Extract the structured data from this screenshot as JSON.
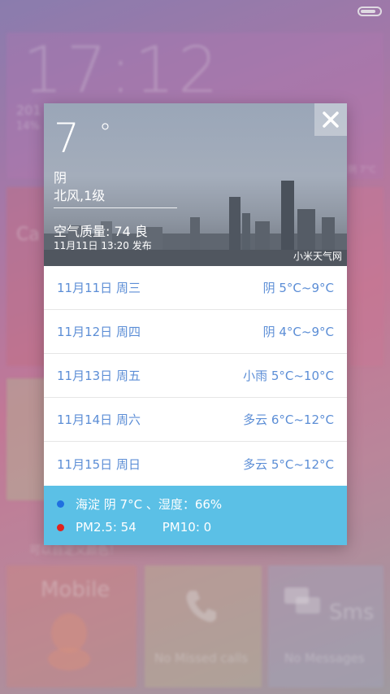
{
  "background": {
    "clock": "17:12",
    "year_fragment": "201",
    "percent_fragment": "14%",
    "camera_fragment": "Ca",
    "custom_color_text": "可以自定义颜色！",
    "right_temp_fragment": "阴 7°C",
    "mobile_label": "Mobile",
    "missed_calls": "No Missed calls",
    "sms_label": "Sms",
    "no_messages": "No Messages",
    "colors": {
      "tile_pink": "#d97aa0",
      "tile_purple": "#9d86c4",
      "tile_green": "#b7c9a0"
    }
  },
  "weather": {
    "temperature": "7",
    "unit": "°",
    "condition": "阴",
    "wind": "北风,1级",
    "air_quality": "空气质量: 74 良",
    "published": "11月11日  13:20 发布",
    "source": "小米天气网"
  },
  "forecast": [
    {
      "date": "11月11日 周三",
      "summary": "阴 5°C~9°C"
    },
    {
      "date": "11月12日 周四",
      "summary": "阴 4°C~9°C"
    },
    {
      "date": "11月13日 周五",
      "summary": "小雨 5°C~10°C"
    },
    {
      "date": "11月14日 周六",
      "summary": "多云 6°C~12°C"
    },
    {
      "date": "11月15日 周日",
      "summary": "多云 5°C~12°C"
    }
  ],
  "footer": {
    "location_line": "海淀 阴 7°C 、湿度：66%",
    "pm25": "PM2.5: 54",
    "pm10": "PM10: 0",
    "dot_blue": "#1f6fe0",
    "dot_red": "#e0231f"
  },
  "colors": {
    "accent": "#5c8ed6",
    "footer_bg": "#5bc0e6"
  }
}
